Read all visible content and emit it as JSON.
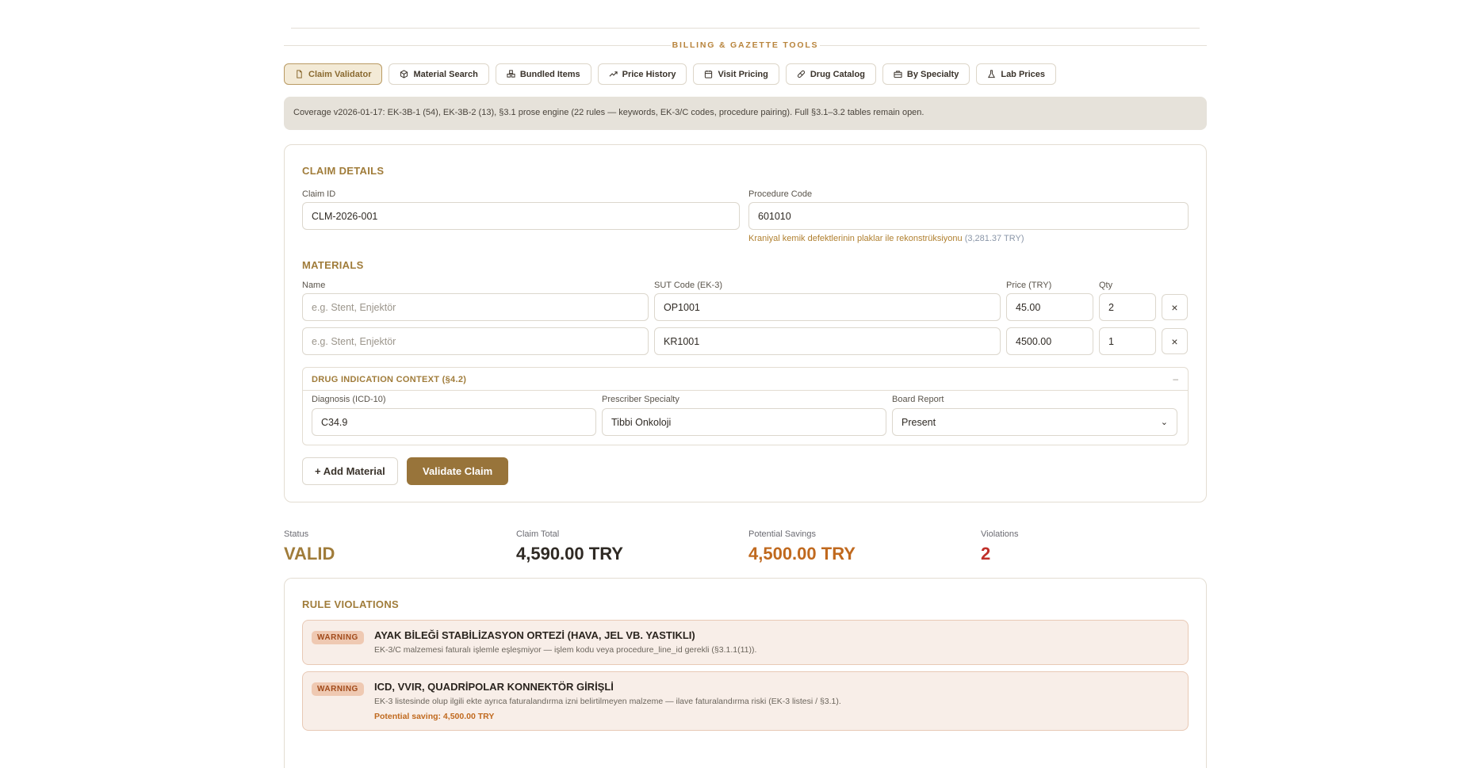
{
  "section": {
    "title": "BILLING & GAZETTE TOOLS"
  },
  "tabs": [
    {
      "label": "Claim Validator",
      "icon": "file-icon",
      "active": true
    },
    {
      "label": "Material Search",
      "icon": "package-icon"
    },
    {
      "label": "Bundled Items",
      "icon": "boxes-icon"
    },
    {
      "label": "Price History",
      "icon": "trending-up-icon"
    },
    {
      "label": "Visit Pricing",
      "icon": "calendar-icon"
    },
    {
      "label": "Drug Catalog",
      "icon": "pill-icon"
    },
    {
      "label": "By Specialty",
      "icon": "briefcase-icon"
    },
    {
      "label": "Lab Prices",
      "icon": "flask-icon"
    }
  ],
  "coverage": "Coverage v2026-01-17: EK-3B-1 (54), EK-3B-2 (13), §3.1 prose engine (22 rules — keywords, EK-3/C codes, procedure pairing). Full §3.1–3.2 tables remain open.",
  "claim": {
    "heading": "CLAIM DETAILS",
    "claim_id_label": "Claim ID",
    "claim_id": "CLM-2026-001",
    "procedure_label": "Procedure Code",
    "procedure_code": "601010",
    "procedure_desc": "Kraniyal kemik defektlerinin plaklar ile rekonstrüksiyonu",
    "procedure_price": "(3,281.37 TRY)"
  },
  "materials": {
    "heading": "MATERIALS",
    "col_name": "Name",
    "col_sut": "SUT Code (EK-3)",
    "col_price": "Price (TRY)",
    "col_qty": "Qty",
    "name_placeholder": "e.g. Stent, Enjektör",
    "remove_symbol": "×",
    "rows": [
      {
        "sut": "OP1001",
        "price": "45.00",
        "qty": "2"
      },
      {
        "sut": "KR1001",
        "price": "4500.00",
        "qty": "1"
      }
    ]
  },
  "drug": {
    "heading": "DRUG INDICATION CONTEXT (§4.2)",
    "collapse": "–",
    "diag_label": "Diagnosis (ICD-10)",
    "diag": "C34.9",
    "spec_label": "Prescriber Specialty",
    "spec": "Tibbi Onkoloji",
    "board_label": "Board Report",
    "board": "Present"
  },
  "actions": {
    "add": "+ Add Material",
    "validate": "Validate Claim"
  },
  "summary": {
    "status_label": "Status",
    "status": "VALID",
    "total_label": "Claim Total",
    "total": "4,590.00 TRY",
    "savings_label": "Potential Savings",
    "savings": "4,500.00 TRY",
    "violations_label": "Violations",
    "violations": "2"
  },
  "violations": {
    "heading": "RULE VIOLATIONS",
    "items": [
      {
        "level": "WARNING",
        "title": "AYAK BİLEĞİ STABİLİZASYON ORTEZİ (HAVA, JEL VB. YASTIKLI)",
        "desc": "EK-3/C malzemesi faturalı işlemle eşleşmiyor — işlem kodu veya procedure_line_id gerekli (§3.1.1(11))."
      },
      {
        "level": "WARNING",
        "title": "ICD, VVIR, QUADRİPOLAR KONNEKTÖR GİRİŞLİ",
        "desc": "EK-3 listesinde olup ilgili ekte ayrıca faturalandırma izni belirtilmeyen malzeme — ilave faturalandırma riski (EK-3 listesi / §3.1).",
        "saving": "Potential saving: 4,500.00 TRY"
      }
    ]
  },
  "colors": {
    "accent": "#98743a",
    "status_valid": "#a07c3a",
    "savings": "#c0691e",
    "violations": "#c0302a"
  }
}
